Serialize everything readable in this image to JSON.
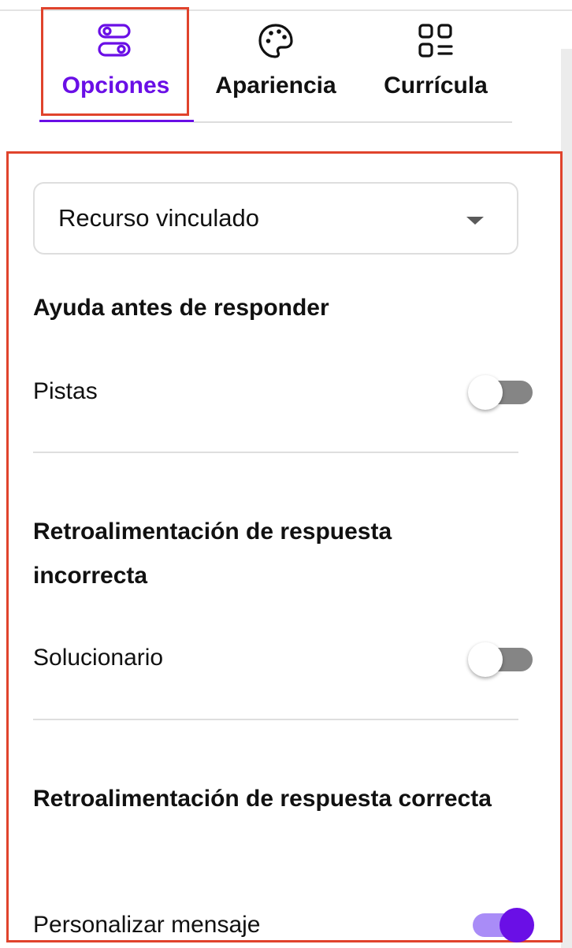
{
  "tabs": [
    {
      "label": "Opciones",
      "icon": "toggles-icon",
      "active": true
    },
    {
      "label": "Apariencia",
      "icon": "palette-icon",
      "active": false
    },
    {
      "label": "Currícula",
      "icon": "grid-list-icon",
      "active": false
    }
  ],
  "linked_resource": {
    "selected": "Recurso vinculado"
  },
  "sections": [
    {
      "heading": "Ayuda antes de responder",
      "setting": {
        "label": "Pistas",
        "enabled": false
      }
    },
    {
      "heading": "Retroalimentación de respuesta incorrecta",
      "setting": {
        "label": "Solucionario",
        "enabled": false
      }
    },
    {
      "heading": "Retroalimentación de respuesta correcta",
      "setting": {
        "label": "Personalizar mensaje",
        "enabled": true
      }
    }
  ],
  "colors": {
    "accent": "#6a0fe6",
    "highlight": "#e0432c",
    "toggle_off": "#858585",
    "toggle_on_track": "#a98cf7"
  }
}
